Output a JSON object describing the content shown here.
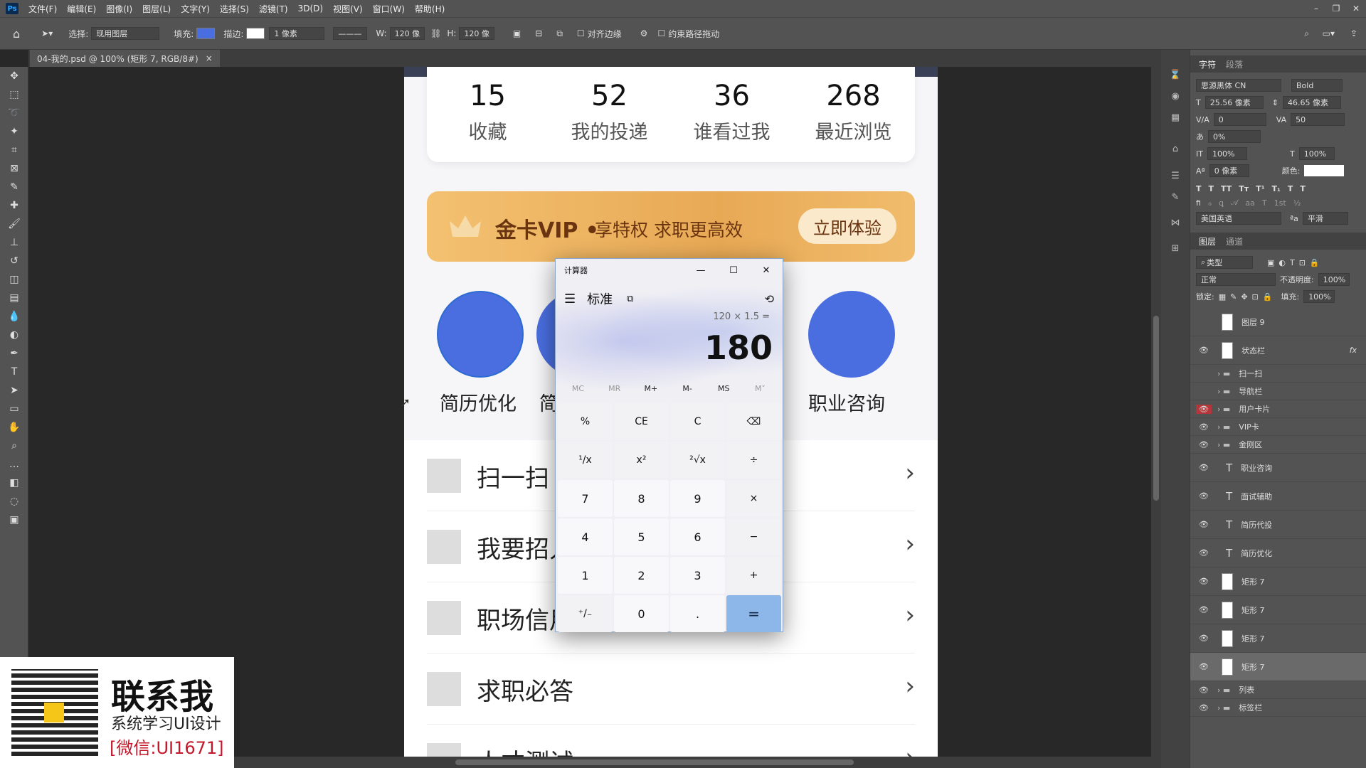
{
  "menubar": {
    "logo": "Ps",
    "items": [
      "文件(F)",
      "编辑(E)",
      "图像(I)",
      "图层(L)",
      "文字(Y)",
      "选择(S)",
      "滤镜(T)",
      "3D(D)",
      "视图(V)",
      "窗口(W)",
      "帮助(H)"
    ]
  },
  "options": {
    "select_label": "选择:",
    "select_value": "现用图层",
    "fill_label": "填充:",
    "stroke_label": "描边:",
    "stroke_width": "1 像素",
    "w_label": "W:",
    "w_value": "120 像",
    "h_label": "H:",
    "h_value": "120 像",
    "align_edges": "对齐边缘",
    "constrain_path": "约束路径拖动"
  },
  "tab": {
    "title": "04-我的.psd @ 100% (矩形 7, RGB/8#)",
    "close": "×"
  },
  "artboard": {
    "stats": [
      {
        "n": "15",
        "l": "收藏"
      },
      {
        "n": "52",
        "l": "我的投递"
      },
      {
        "n": "36",
        "l": "谁看过我"
      },
      {
        "n": "268",
        "l": "最近浏览"
      }
    ],
    "vip": {
      "title": "金卡VIP •",
      "sub": "享特权 求职更高效",
      "button": "立即体验"
    },
    "circles": [
      "简历优化",
      "简",
      "职业咨询"
    ],
    "rows": [
      "扫一扫",
      "我要招人",
      "职场信用",
      "求职必答",
      "人才测试"
    ]
  },
  "calculator": {
    "title": "计算器",
    "mode": "标准",
    "expression": "120 × 1.5 =",
    "result": "180",
    "memory": [
      "MC",
      "MR",
      "M+",
      "M-",
      "MS",
      "M˅"
    ],
    "keys": [
      "%",
      "CE",
      "C",
      "⌫",
      "¹/x",
      "x²",
      "²√x",
      "÷",
      "7",
      "8",
      "9",
      "×",
      "4",
      "5",
      "6",
      "−",
      "1",
      "2",
      "3",
      "+",
      "⁺/₋",
      "0",
      ".",
      "="
    ]
  },
  "panels": {
    "tabs_top": [
      "字符",
      "段落"
    ],
    "font_family": "思源黑体 CN",
    "font_style": "Bold",
    "font_size": "25.56 像素",
    "leading": "46.65 像素",
    "kerning": "0",
    "tracking": "50",
    "scale_pct": "0%",
    "vscale": "100%",
    "hscale": "100%",
    "baseline": "0 像素",
    "color_label": "颜色:",
    "language": "美国英语",
    "antialias": "平滑",
    "tabs_layers": [
      "图层",
      "通道"
    ],
    "filter": "类型",
    "blend": "正常",
    "opacity_label": "不透明度:",
    "opacity": "100%",
    "lock_label": "锁定:",
    "fill_label": "填充:",
    "fill": "100%",
    "layers": [
      {
        "name": "图层 9",
        "kind": "thumb",
        "eye": ""
      },
      {
        "name": "状态栏",
        "kind": "thumb",
        "eye": "👁",
        "fx": "fx"
      },
      {
        "name": "扫一扫",
        "kind": "group",
        "eye": ""
      },
      {
        "name": "导航栏",
        "kind": "group",
        "eye": ""
      },
      {
        "name": "用户卡片",
        "kind": "group",
        "eye": "👁"
      },
      {
        "name": "VIP卡",
        "kind": "group",
        "eye": "👁"
      },
      {
        "name": "金刚区",
        "kind": "group",
        "eye": "👁"
      },
      {
        "name": "职业咨询",
        "kind": "text",
        "eye": "👁"
      },
      {
        "name": "面试辅助",
        "kind": "text",
        "eye": "👁"
      },
      {
        "name": "简历代投",
        "kind": "text",
        "eye": "👁"
      },
      {
        "name": "简历优化",
        "kind": "text",
        "eye": "👁"
      },
      {
        "name": "矩形 7",
        "kind": "thumb",
        "eye": "👁"
      },
      {
        "name": "矩形 7",
        "kind": "thumb",
        "eye": "👁"
      },
      {
        "name": "矩形 7",
        "kind": "thumb",
        "eye": "👁"
      },
      {
        "name": "矩形 7",
        "kind": "thumb",
        "eye": "👁"
      },
      {
        "name": "列表",
        "kind": "group",
        "eye": "👁"
      },
      {
        "name": "标签栏",
        "kind": "group",
        "eye": "👁"
      }
    ]
  },
  "promo": {
    "big": "联系我",
    "line1": "系统学习UI设计",
    "line2": "[微信:UI1671]"
  }
}
